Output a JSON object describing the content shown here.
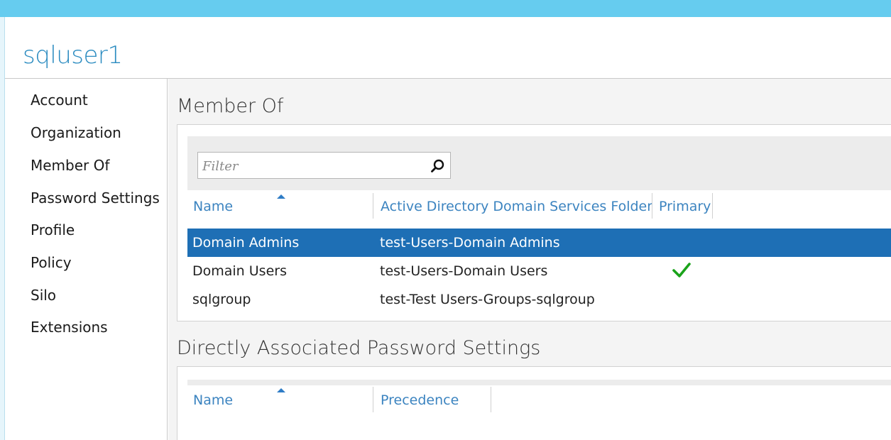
{
  "window": {
    "title": "sqluser1"
  },
  "sidebar": {
    "items": [
      {
        "label": "Account"
      },
      {
        "label": "Organization"
      },
      {
        "label": "Member Of"
      },
      {
        "label": "Password Settings"
      },
      {
        "label": "Profile"
      },
      {
        "label": "Policy"
      },
      {
        "label": "Silo"
      },
      {
        "label": "Extensions"
      }
    ]
  },
  "member_of": {
    "title": "Member Of",
    "filter": {
      "placeholder": "Filter",
      "value": ""
    },
    "columns": [
      "Name",
      "Active Directory Domain Services Folder",
      "Primary"
    ],
    "sorted_column": "Name",
    "rows": [
      {
        "name": "Domain Admins",
        "folder": "test-Users-Domain Admins",
        "primary": false,
        "selected": true
      },
      {
        "name": "Domain Users",
        "folder": "test-Users-Domain Users",
        "primary": true,
        "selected": false
      },
      {
        "name": "sqlgroup",
        "folder": "test-Test Users-Groups-sqlgroup",
        "primary": false,
        "selected": false
      }
    ]
  },
  "password_settings": {
    "title": "Directly Associated Password Settings",
    "columns": [
      "Name",
      "Precedence"
    ],
    "sorted_column": "Name",
    "rows": []
  },
  "colors": {
    "top_bar": "#66ccef",
    "title": "#2a8bc0",
    "header_text": "#3c84c0",
    "selection": "#1e6fb5",
    "check": "#1aa31a"
  },
  "icons": {
    "filter_search": "search-icon",
    "primary_check": "checkmark-icon",
    "sort": "sort-ascending-icon"
  }
}
